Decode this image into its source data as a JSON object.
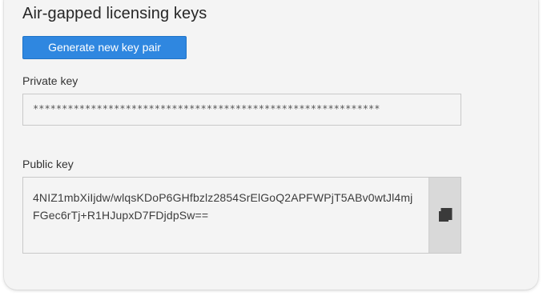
{
  "panel": {
    "title": "Air-gapped licensing keys",
    "generate_button_label": "Generate new key pair",
    "private_key": {
      "label": "Private key",
      "value": "************************************************************"
    },
    "public_key": {
      "label": "Public key",
      "value": "4NIZ1mbXiIjdw/wlqsKDoP6GHfbzlz2854SrElGoQ2APFWPjT5ABv0wtJl4mjFGec6rTj+R1HJupxD7FDjdpSw==",
      "copy_icon": "copy-icon"
    }
  },
  "colors": {
    "accent": "#2f87e0",
    "panel_background": "#f4f4f4",
    "copy_button_background": "#d9d9d9"
  }
}
